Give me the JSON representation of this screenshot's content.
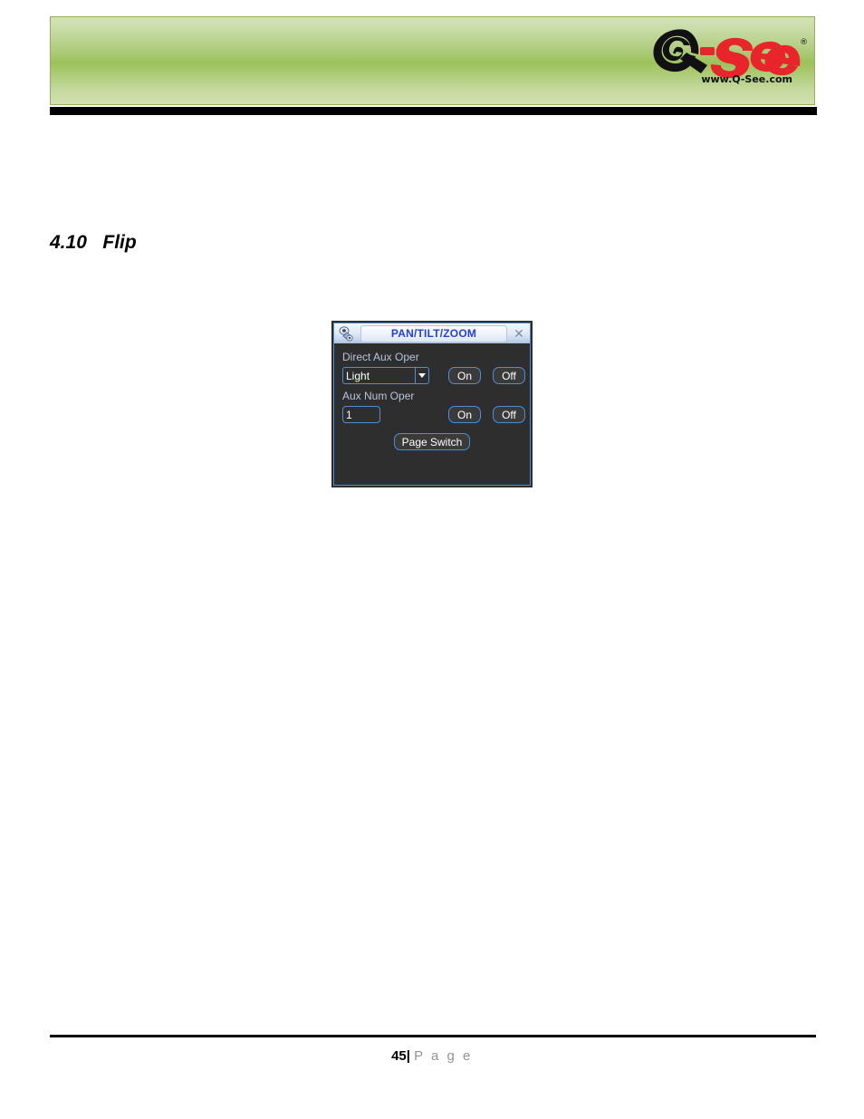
{
  "document": {
    "brand": {
      "logo_q": "Q",
      "logo_dash_see": "-See",
      "logo_registered": "®",
      "website": "www.Q-See.com"
    },
    "section": {
      "number": "4.10",
      "title": "Flip",
      "heading": "4.10   Flip"
    },
    "footer": {
      "page_number": "45",
      "separator": "|",
      "page_word": "P a g e"
    }
  },
  "ptz_dialog": {
    "title": "PAN/TILT/ZOOM",
    "icon": "ptz-camera-icon",
    "close_label": "✕",
    "sections": {
      "direct_aux": {
        "label": "Direct Aux Oper",
        "select_value": "Light",
        "select_options": [
          "Light"
        ],
        "on_label": "On",
        "off_label": "Off"
      },
      "aux_num": {
        "label": "Aux Num Oper",
        "input_value": "1",
        "on_label": "On",
        "off_label": "Off"
      }
    },
    "page_switch_label": "Page Switch"
  },
  "colors": {
    "banner_light": "#d3e2b4",
    "banner_mid": "#9cc25b",
    "banner_border": "#93ad5a",
    "dialog_border_blue": "#4d8fd6",
    "dialog_bg": "#2e2e2e",
    "title_text_blue": "#2440d8",
    "label_text": "#b9c4da",
    "logo_red": "#e8252a",
    "footer_gray": "#939393"
  }
}
